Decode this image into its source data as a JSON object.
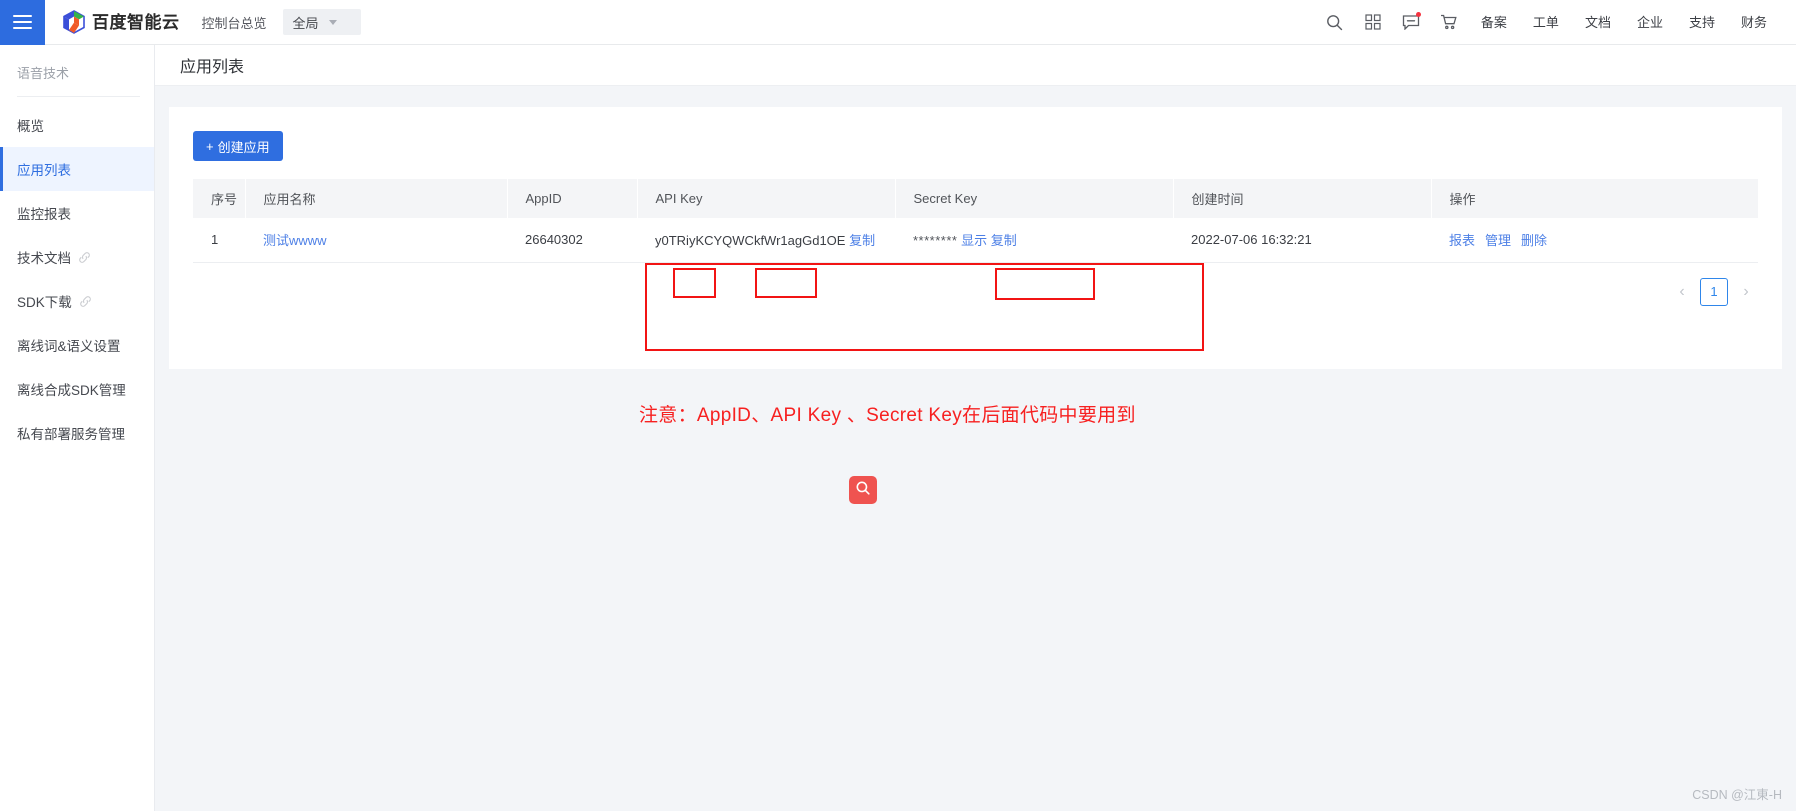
{
  "header": {
    "menu_icon": "hamburger-icon",
    "brand": "百度智能云",
    "console_overview": "控制台总览",
    "scope_value": "全局",
    "icons": [
      {
        "name": "search-icon",
        "label": "搜索"
      },
      {
        "name": "apps-grid-icon",
        "label": "应用"
      },
      {
        "name": "message-icon",
        "label": "消息",
        "badge": true
      },
      {
        "name": "cart-icon",
        "label": "购物车"
      }
    ],
    "links": [
      "备案",
      "工单",
      "文档",
      "企业",
      "支持",
      "财务"
    ]
  },
  "sidebar": {
    "title": "语音技术",
    "items": [
      {
        "label": "概览",
        "active": false,
        "external": false
      },
      {
        "label": "应用列表",
        "active": true,
        "external": false
      },
      {
        "label": "监控报表",
        "active": false,
        "external": false
      },
      {
        "label": "技术文档",
        "active": false,
        "external": true
      },
      {
        "label": "SDK下载",
        "active": false,
        "external": true
      },
      {
        "label": "离线词&语义设置",
        "active": false,
        "external": false
      },
      {
        "label": "离线合成SDK管理",
        "active": false,
        "external": false
      },
      {
        "label": "私有部署服务管理",
        "active": false,
        "external": false
      }
    ]
  },
  "main": {
    "page_title": "应用列表",
    "create_button": "创建应用",
    "create_button_plus": "+",
    "table": {
      "columns": [
        "序号",
        "应用名称",
        "AppID",
        "API Key",
        "Secret Key",
        "创建时间",
        "操作"
      ],
      "rows": [
        {
          "index": "1",
          "app_name": "测试wwww",
          "app_id": "26640302",
          "api_key": "y0TRiyKCYQWCkfWr1agGd1OE",
          "api_key_copy": "复制",
          "secret_key_mask": "********",
          "secret_key_show": "显示",
          "secret_key_copy": "复制",
          "created_at": "2022-07-06 16:32:21",
          "operations": [
            "报表",
            "管理",
            "删除"
          ]
        }
      ]
    },
    "pagination": {
      "prev": "‹",
      "current_page": "1",
      "next": "›"
    }
  },
  "annotations": {
    "note": "注意：AppID、API Key 、Secret Key在后面代码中要用到",
    "note_color": "#f72020",
    "box_color": "#f21414",
    "search_button_icon": "magnifier-icon",
    "search_button_color": "#ef5350"
  },
  "watermark": "CSDN @江東-H",
  "theme": {
    "primary": "#2f6ee0",
    "sidebar_active_bg": "#eef4ff",
    "link": "#4c7fe6",
    "page_bg": "#f3f5f8"
  }
}
